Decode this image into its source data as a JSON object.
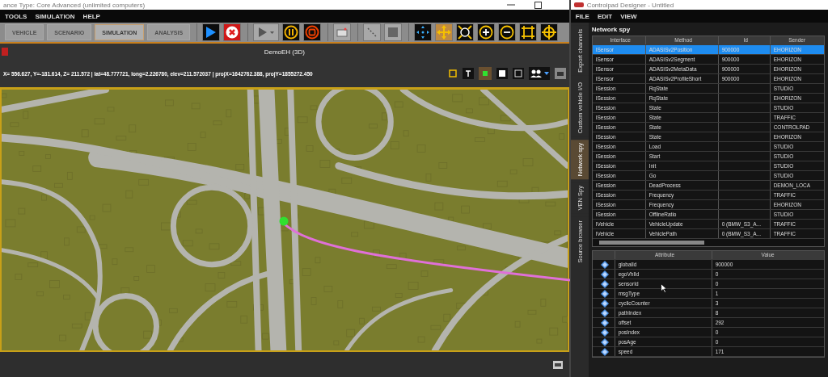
{
  "main_window": {
    "title": "ance Type: Core Advanced (unlimited computers)",
    "menu": [
      "TOOLS",
      "SIMULATION",
      "HELP"
    ],
    "tabs": [
      {
        "label": "VEHICLE",
        "selected": false
      },
      {
        "label": "SCENARIO",
        "selected": false
      },
      {
        "label": "SIMULATION",
        "selected": true
      },
      {
        "label": "ANALYSIS",
        "selected": false
      }
    ],
    "view": {
      "title": "DemoEH (3D)",
      "coordinates": "X= 556.627, Y=-181.614, Z= 211.572 | lat=48.777721, long=2.226780, elev=211.572037 | projX=1642762.388, projY=1855272.450"
    }
  },
  "designer_window": {
    "title": "Controlpad Designer - Untitled",
    "menu": [
      "FILE",
      "EDIT",
      "VIEW"
    ],
    "side_tabs": [
      {
        "label": "Export channels",
        "selected": false
      },
      {
        "label": "Custom vehicle I/O",
        "selected": false
      },
      {
        "label": "Network spy",
        "selected": true
      },
      {
        "label": "VEN Spy",
        "selected": false
      },
      {
        "label": "Source browser",
        "selected": false
      }
    ],
    "panel_title": "Network spy",
    "messages": {
      "columns": [
        "Interface",
        "Method",
        "Id",
        "Sender"
      ],
      "rows": [
        {
          "cells": [
            "ISensor",
            "ADASISv2Position",
            "900000",
            "EHORIZON"
          ],
          "selected": true
        },
        {
          "cells": [
            "ISensor",
            "ADASISv2Segment",
            "900000",
            "EHORIZON"
          ],
          "selected": false
        },
        {
          "cells": [
            "ISensor",
            "ADASISv2MetaData",
            "900000",
            "EHORIZON"
          ],
          "selected": false
        },
        {
          "cells": [
            "ISensor",
            "ADASISv2ProfileShort",
            "900000",
            "EHORIZON"
          ],
          "selected": false
        },
        {
          "cells": [
            "ISession",
            "RqState",
            "",
            "STUDIO"
          ],
          "selected": false
        },
        {
          "cells": [
            "ISession",
            "RqState",
            "",
            "EHORIZON"
          ],
          "selected": false
        },
        {
          "cells": [
            "ISession",
            "State",
            "",
            "STUDIO"
          ],
          "selected": false
        },
        {
          "cells": [
            "ISession",
            "State",
            "",
            "TRAFFIC"
          ],
          "selected": false
        },
        {
          "cells": [
            "ISession",
            "State",
            "",
            "CONTROLPAD"
          ],
          "selected": false
        },
        {
          "cells": [
            "ISession",
            "State",
            "",
            "EHORIZON"
          ],
          "selected": false
        },
        {
          "cells": [
            "ISession",
            "Load",
            "",
            "STUDIO"
          ],
          "selected": false
        },
        {
          "cells": [
            "ISession",
            "Start",
            "",
            "STUDIO"
          ],
          "selected": false
        },
        {
          "cells": [
            "ISession",
            "Init",
            "",
            "STUDIO"
          ],
          "selected": false
        },
        {
          "cells": [
            "ISession",
            "Go",
            "",
            "STUDIO"
          ],
          "selected": false
        },
        {
          "cells": [
            "ISession",
            "DeadProcess",
            "",
            "DEMON_LOCA"
          ],
          "selected": false
        },
        {
          "cells": [
            "ISession",
            "Frequency",
            "",
            "TRAFFIC"
          ],
          "selected": false
        },
        {
          "cells": [
            "ISession",
            "Frequency",
            "",
            "EHORIZON"
          ],
          "selected": false
        },
        {
          "cells": [
            "ISession",
            "OfflineRatio",
            "",
            "STUDIO"
          ],
          "selected": false
        },
        {
          "cells": [
            "IVehicle",
            "VehicleUpdate",
            "0 (BMW_S3_A...",
            "TRAFFIC"
          ],
          "selected": false
        },
        {
          "cells": [
            "IVehicle",
            "VehiclePath",
            "0 (BMW_S3_A...",
            "TRAFFIC"
          ],
          "selected": false
        }
      ]
    },
    "attributes": {
      "columns": [
        "Attribute",
        "Value"
      ],
      "rows": [
        {
          "attribute": "globalId",
          "value": "900000"
        },
        {
          "attribute": "egoVhlId",
          "value": "0"
        },
        {
          "attribute": "sensorId",
          "value": "0"
        },
        {
          "attribute": "msgType",
          "value": "1"
        },
        {
          "attribute": "cyclicCounter",
          "value": "3"
        },
        {
          "attribute": "pathIndex",
          "value": "8"
        },
        {
          "attribute": "offset",
          "value": "292"
        },
        {
          "attribute": "posIndex",
          "value": "0"
        },
        {
          "attribute": "posAge",
          "value": "0"
        },
        {
          "attribute": "speed",
          "value": "171"
        }
      ]
    }
  }
}
